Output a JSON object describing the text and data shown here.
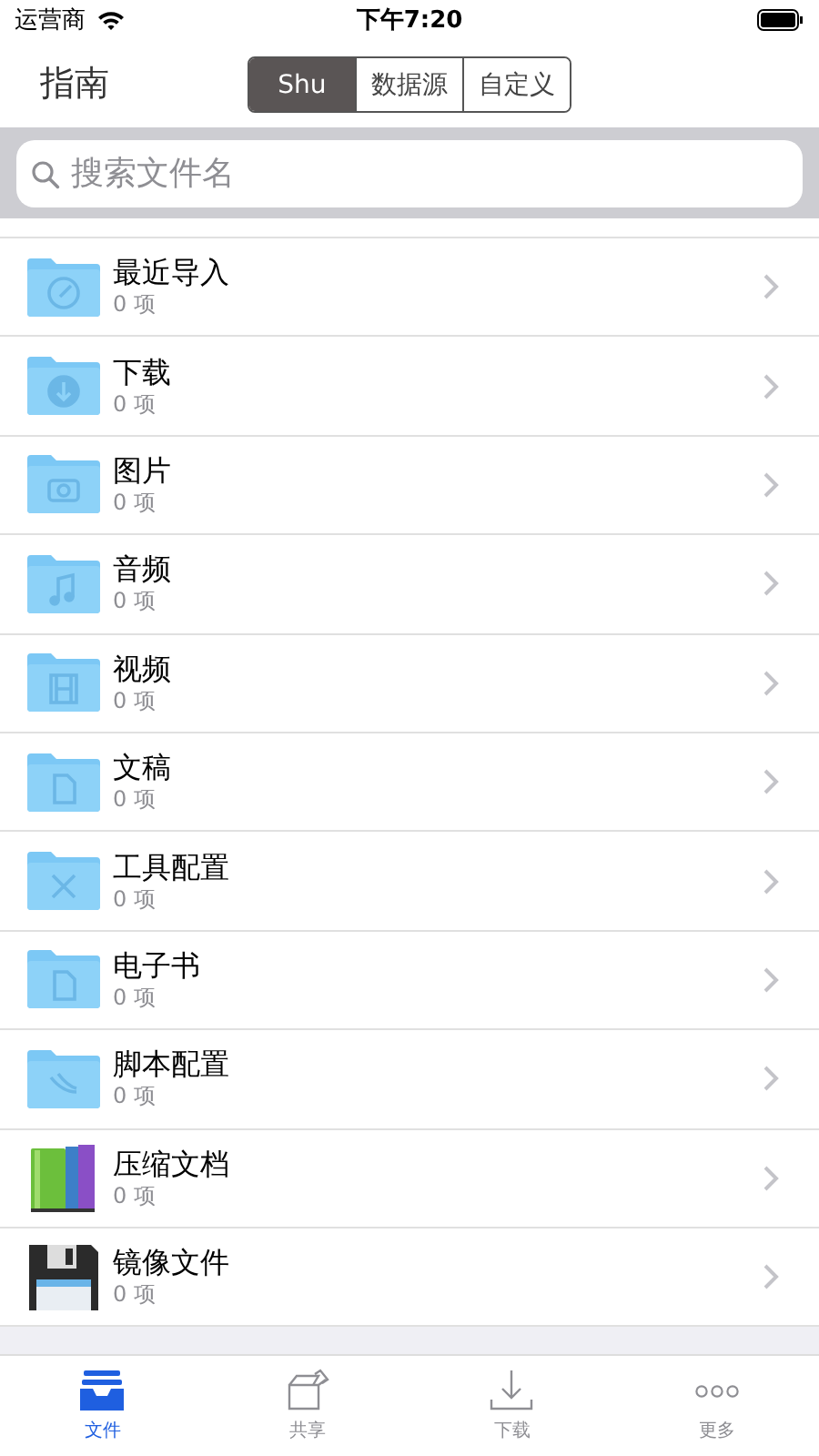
{
  "status_bar": {
    "carrier": "运营商",
    "time": "下午7:20"
  },
  "nav": {
    "title": "指南",
    "segments": [
      {
        "label": "Shu",
        "selected": true
      },
      {
        "label": "数据源",
        "selected": false
      },
      {
        "label": "自定义",
        "selected": false
      }
    ]
  },
  "search": {
    "placeholder": "搜索文件名"
  },
  "items": [
    {
      "kind": "recent",
      "name": "最近导入",
      "count": "0 项"
    },
    {
      "kind": "download",
      "name": "下载",
      "count": "0 项"
    },
    {
      "kind": "photo",
      "name": "图片",
      "count": "0 项"
    },
    {
      "kind": "audio",
      "name": "音频",
      "count": "0 项"
    },
    {
      "kind": "video",
      "name": "视频",
      "count": "0 项"
    },
    {
      "kind": "document",
      "name": "文稿",
      "count": "0 项"
    },
    {
      "kind": "tools",
      "name": "工具配置",
      "count": "0 项"
    },
    {
      "kind": "document",
      "name": "电子书",
      "count": "0 项"
    },
    {
      "kind": "script",
      "name": "脚本配置",
      "count": "0 项"
    },
    {
      "kind": "archive",
      "name": "压缩文档",
      "count": "0 项"
    },
    {
      "kind": "disk",
      "name": "镜像文件",
      "count": "0 项"
    }
  ],
  "tab_bar": [
    {
      "kind": "files",
      "label": "文件",
      "selected": true
    },
    {
      "kind": "share",
      "label": "共享",
      "selected": false
    },
    {
      "kind": "download",
      "label": "下载",
      "selected": false
    },
    {
      "kind": "more",
      "label": "更多",
      "selected": false
    }
  ]
}
